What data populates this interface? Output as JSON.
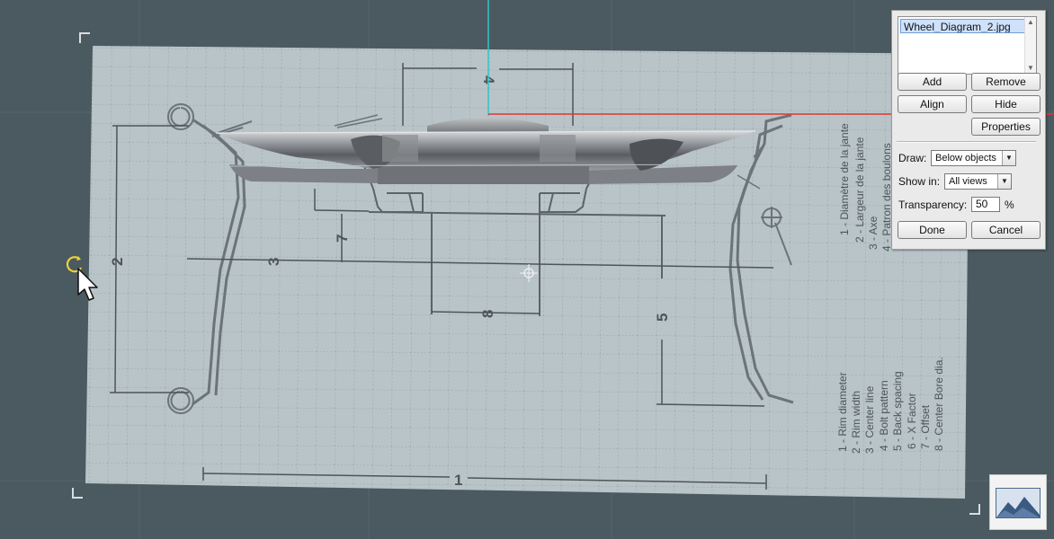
{
  "background_panel": {
    "image_list": [
      "Wheel_Diagram_2.jpg"
    ],
    "buttons": {
      "add": "Add",
      "remove": "Remove",
      "align": "Align",
      "hide": "Hide",
      "properties": "Properties",
      "done": "Done",
      "cancel": "Cancel"
    },
    "draw": {
      "label": "Draw:",
      "value": "Below objects"
    },
    "show_in": {
      "label": "Show in:",
      "value": "All views"
    },
    "transparency": {
      "label": "Transparency:",
      "value": "50",
      "unit": "%"
    }
  },
  "diagram": {
    "dimension_numbers": [
      "1",
      "2",
      "3",
      "4",
      "5",
      "7",
      "8"
    ],
    "legend_fr": [
      "1 - Diamètre de la jante",
      "2 - Largeur de la jante",
      "3 - Axe",
      "4 - Patron des boulons"
    ],
    "legend_en": [
      "1 - Rim diameter",
      "2 - Rim width",
      "3 - Center line",
      "4 - Bolt pattern",
      "5 - Back spacing",
      "6 - X Factor",
      "7 - Offset",
      "8 - Center Bore dia."
    ]
  },
  "colors": {
    "viewport_bg": "#4b5960",
    "paper": "#b9c4c8",
    "axis_x": "#e0362f",
    "axis_y": "#2fc8c6",
    "selection_list": "#cfe2fb"
  },
  "icons": {
    "rotate_handle": "rotate-handle-icon",
    "cursor": "arrow-cursor-icon",
    "center": "center-crosshair-icon",
    "thumbnail": "landscape-image-icon"
  }
}
